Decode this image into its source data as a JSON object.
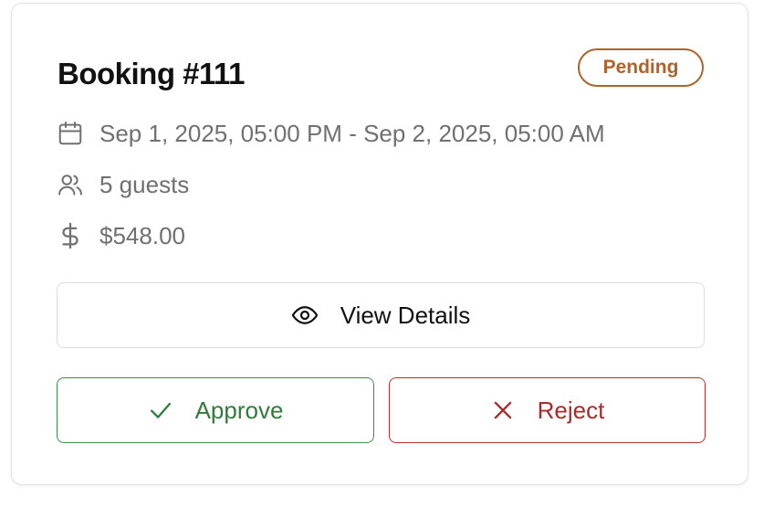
{
  "booking": {
    "title": "Booking #111",
    "status": "Pending",
    "date_range": "Sep 1, 2025, 05:00 PM - Sep 2, 2025, 05:00 AM",
    "guests": "5 guests",
    "price": "$548.00"
  },
  "actions": {
    "view_label": "View Details",
    "approve_label": "Approve",
    "reject_label": "Reject"
  },
  "icons": {
    "date": "calendar-icon",
    "guests": "users-icon",
    "price": "dollar-icon",
    "view": "eye-icon",
    "approve": "check-icon",
    "reject": "x-icon"
  },
  "colors": {
    "status_pending": "#b0622a",
    "approve": "#2f7d3c",
    "reject": "#a82b2a",
    "muted_text": "#707070"
  }
}
